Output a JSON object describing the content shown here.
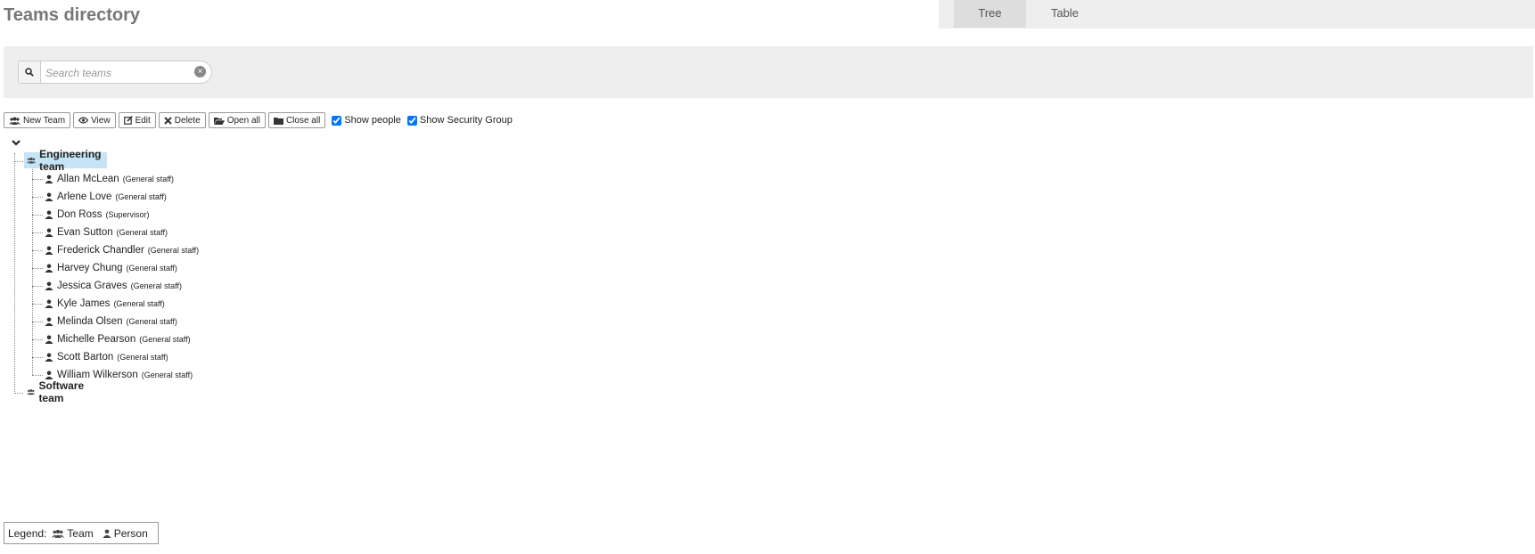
{
  "page": {
    "title": "Teams directory"
  },
  "view_tabs": [
    {
      "label": "Tree",
      "active": true
    },
    {
      "label": "Table",
      "active": false
    }
  ],
  "search": {
    "placeholder": "Search teams",
    "value": ""
  },
  "toolbar": {
    "buttons": [
      {
        "label": "New Team",
        "icon": "team-icon"
      },
      {
        "label": "View",
        "icon": "eye-icon"
      },
      {
        "label": "Edit",
        "icon": "edit-icon"
      },
      {
        "label": "Delete",
        "icon": "delete-icon"
      },
      {
        "label": "Open all",
        "icon": "folder-open-icon"
      },
      {
        "label": "Close all",
        "icon": "folder-icon"
      }
    ],
    "checkboxes": [
      {
        "label": "Show people",
        "checked": true
      },
      {
        "label": "Show Security Group",
        "checked": true
      }
    ]
  },
  "tree": {
    "teams": [
      {
        "name": "Engineering team",
        "expanded": true,
        "selected": true,
        "members": [
          {
            "name": "Allan McLean",
            "role": "(General staff)"
          },
          {
            "name": "Arlene Love",
            "role": "(General staff)"
          },
          {
            "name": "Don Ross",
            "role": "(Supervisor)"
          },
          {
            "name": "Evan Sutton",
            "role": "(General staff)"
          },
          {
            "name": "Frederick Chandler",
            "role": "(General staff)"
          },
          {
            "name": "Harvey Chung",
            "role": "(General staff)"
          },
          {
            "name": "Jessica Graves",
            "role": "(General staff)"
          },
          {
            "name": "Kyle James",
            "role": "(General staff)"
          },
          {
            "name": "Melinda Olsen",
            "role": "(General staff)"
          },
          {
            "name": "Michelle Pearson",
            "role": "(General staff)"
          },
          {
            "name": "Scott Barton",
            "role": "(General staff)"
          },
          {
            "name": "William Wilkerson",
            "role": "(General staff)"
          }
        ]
      },
      {
        "name": "Software team",
        "expanded": false,
        "selected": false,
        "members": []
      }
    ]
  },
  "legend": {
    "label": "Legend:",
    "items": [
      {
        "label": "Team",
        "icon": "team-icon"
      },
      {
        "label": "Person",
        "icon": "person-icon"
      }
    ]
  },
  "colors": {
    "selected_bg": "#c5e4f5",
    "panel_bg": "#eeeeee",
    "title": "#777777"
  }
}
